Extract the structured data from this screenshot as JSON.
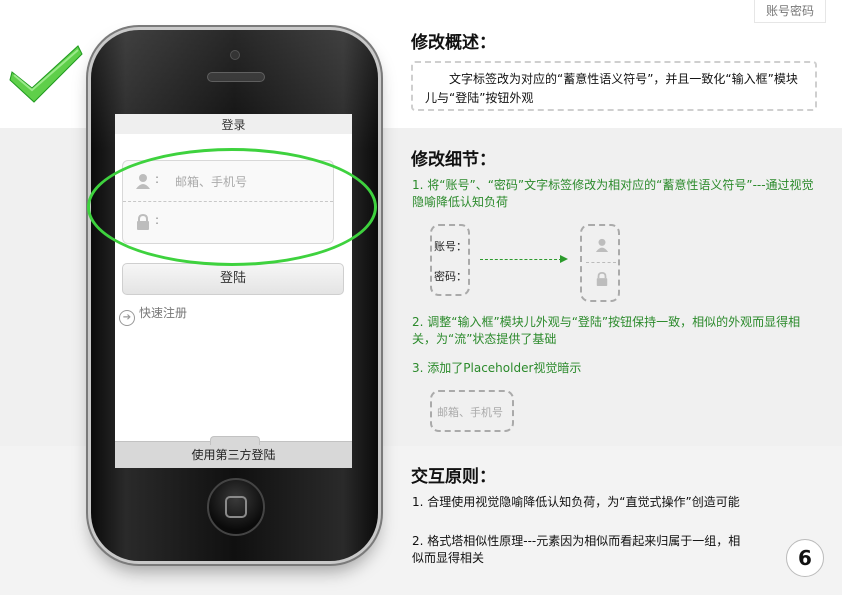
{
  "top_tab": "账号密码",
  "phone": {
    "screen_title": "登录",
    "username_placeholder": "邮箱、手机号",
    "colon": ":",
    "login_button": "登陆",
    "register_link": "快速注册",
    "third_party_bar": "使用第三方登陆"
  },
  "overview": {
    "heading": "修改概述：",
    "text": "文字标签改为对应的“蓄意性语义符号”，并且一致化“输入框”模块儿与“登陆”按钮外观"
  },
  "details": {
    "heading": "修改细节：",
    "item1": "1. 将“账号”、“密码”文字标签修改为相对应的“蓄意性语义符号”---通过视觉隐喻降低认知负荷",
    "label_account": "账号：",
    "label_password": "密码：",
    "item2": "2. 调整“输入框”模块儿外观与“登陆”按钮保持一致，相似的外观而显得相关，为“流”状态提供了基础",
    "item3": "3. 添加了Placeholder视觉暗示",
    "placeholder_demo": "邮箱、手机号"
  },
  "principles": {
    "heading": "交互原则：",
    "item1": "1. 合理使用视觉隐喻降低认知负荷，为“直觉式操作”创造可能",
    "item2": "2. 格式塔相似性原理---元素因为相似而看起来归属于一组，相似而显得相关"
  },
  "page_number": "6",
  "colors": {
    "accent_green": "#2b8a2b",
    "highlight_ellipse": "#3ed23e",
    "check_green": "#22a822"
  },
  "icons": [
    "checkmark-icon",
    "user-icon",
    "lock-icon",
    "arrow-right-icon"
  ]
}
